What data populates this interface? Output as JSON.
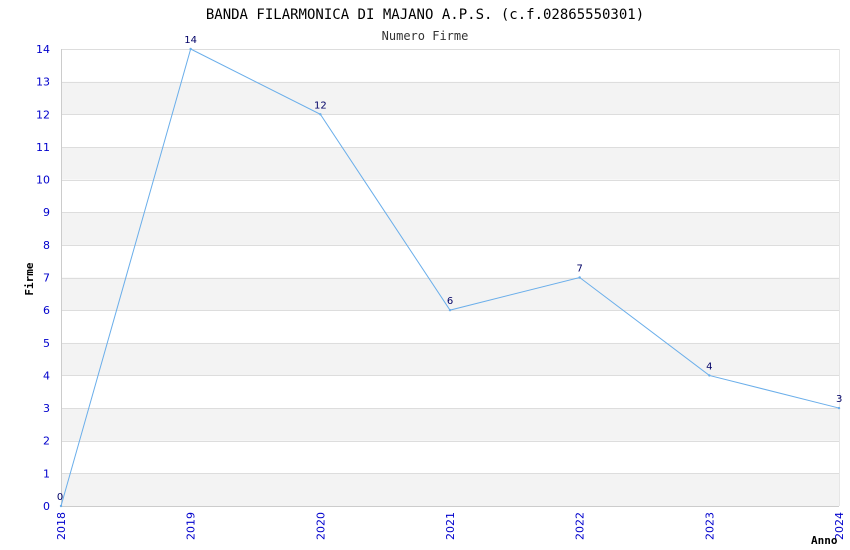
{
  "chart_data": {
    "type": "line",
    "title": "BANDA FILARMONICA DI MAJANO A.P.S. (c.f.02865550301)",
    "subtitle": "Numero Firme",
    "xlabel": "Anno",
    "ylabel": "Firme",
    "x": [
      "2018",
      "2019",
      "2020",
      "2021",
      "2022",
      "2023",
      "2024"
    ],
    "series": [
      {
        "values": [
          0,
          14,
          12,
          6,
          7,
          4,
          3
        ]
      }
    ],
    "ylim": [
      0,
      14
    ],
    "yticks": [
      "0",
      "1",
      "2",
      "3",
      "4",
      "5",
      "6",
      "7",
      "8",
      "9",
      "10",
      "11",
      "12",
      "13",
      "14"
    ],
    "grid": true,
    "legend": "none",
    "colors": {
      "line": "#6aaeea",
      "band_odd": "#f3f3f3",
      "band_even": "#ffffff",
      "tick_text": "#0000cc",
      "data_label": "#000066"
    }
  }
}
